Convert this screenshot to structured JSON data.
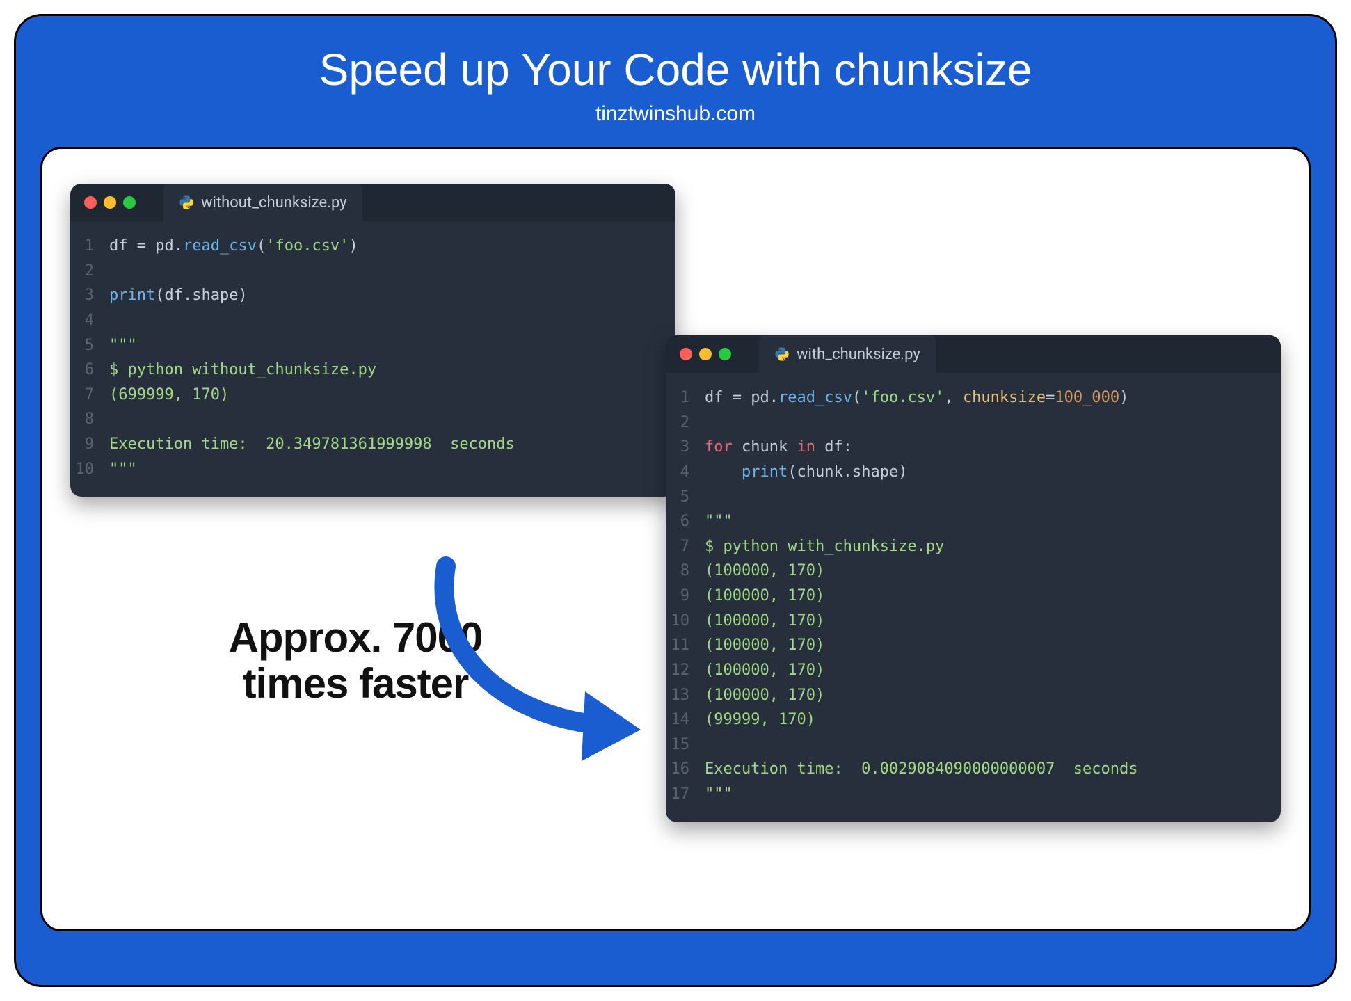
{
  "header": {
    "title": "Speed up Your Code with chunksize",
    "subtitle": "tinztwinshub.com"
  },
  "callout": {
    "line1": "Approx. 7000",
    "line2": "times faster"
  },
  "window_left": {
    "filename": "without_chunksize.py",
    "lines": [
      {
        "n": "1",
        "html": "<span class='tok-name'>df</span> <span class='tok-op'>=</span> <span class='tok-name'>pd</span><span class='tok-op'>.</span><span class='tok-call'>read_csv</span><span class='tok-op'>(</span><span class='tok-str'>'foo.csv'</span><span class='tok-op'>)</span>"
      },
      {
        "n": "2",
        "html": ""
      },
      {
        "n": "3",
        "html": "<span class='tok-builtin'>print</span><span class='tok-op'>(</span><span class='tok-name'>df</span><span class='tok-op'>.</span><span class='tok-name'>shape</span><span class='tok-op'>)</span>"
      },
      {
        "n": "4",
        "html": ""
      },
      {
        "n": "5",
        "html": "<span class='tok-comment'>\"\"\"</span>"
      },
      {
        "n": "6",
        "html": "<span class='tok-comment'>$ python without_chunksize.py</span>"
      },
      {
        "n": "7",
        "html": "<span class='tok-comment'>(699999, 170)</span>"
      },
      {
        "n": "8",
        "html": ""
      },
      {
        "n": "9",
        "html": "<span class='tok-comment'>Execution time:  20.349781361999998  seconds</span>"
      },
      {
        "n": "10",
        "html": "<span class='tok-comment'>\"\"\"</span>"
      }
    ]
  },
  "window_right": {
    "filename": "with_chunksize.py",
    "lines": [
      {
        "n": "1",
        "html": "<span class='tok-name'>df</span> <span class='tok-op'>=</span> <span class='tok-name'>pd</span><span class='tok-op'>.</span><span class='tok-call'>read_csv</span><span class='tok-op'>(</span><span class='tok-str'>'foo.csv'</span><span class='tok-op'>,</span> <span class='tok-param'>chunksize</span><span class='tok-op'>=</span><span class='tok-num'>100_000</span><span class='tok-op'>)</span>"
      },
      {
        "n": "2",
        "html": ""
      },
      {
        "n": "3",
        "html": "<span class='tok-kw'>for</span> <span class='tok-name'>chunk</span> <span class='tok-kw'>in</span> <span class='tok-name'>df</span><span class='tok-op'>:</span>"
      },
      {
        "n": "4",
        "html": "    <span class='tok-builtin'>print</span><span class='tok-op'>(</span><span class='tok-name'>chunk</span><span class='tok-op'>.</span><span class='tok-name'>shape</span><span class='tok-op'>)</span>"
      },
      {
        "n": "5",
        "html": ""
      },
      {
        "n": "6",
        "html": "<span class='tok-comment'>\"\"\"</span>"
      },
      {
        "n": "7",
        "html": "<span class='tok-comment'>$ python with_chunksize.py</span>"
      },
      {
        "n": "8",
        "html": "<span class='tok-comment'>(100000, 170)</span>"
      },
      {
        "n": "9",
        "html": "<span class='tok-comment'>(100000, 170)</span>"
      },
      {
        "n": "10",
        "html": "<span class='tok-comment'>(100000, 170)</span>"
      },
      {
        "n": "11",
        "html": "<span class='tok-comment'>(100000, 170)</span>"
      },
      {
        "n": "12",
        "html": "<span class='tok-comment'>(100000, 170)</span>"
      },
      {
        "n": "13",
        "html": "<span class='tok-comment'>(100000, 170)</span>"
      },
      {
        "n": "14",
        "html": "<span class='tok-comment'>(99999, 170)</span>"
      },
      {
        "n": "15",
        "html": ""
      },
      {
        "n": "16",
        "html": "<span class='tok-comment'>Execution time:  0.0029084090000000007  seconds</span>"
      },
      {
        "n": "17",
        "html": "<span class='tok-comment'>\"\"\"</span>"
      }
    ]
  }
}
